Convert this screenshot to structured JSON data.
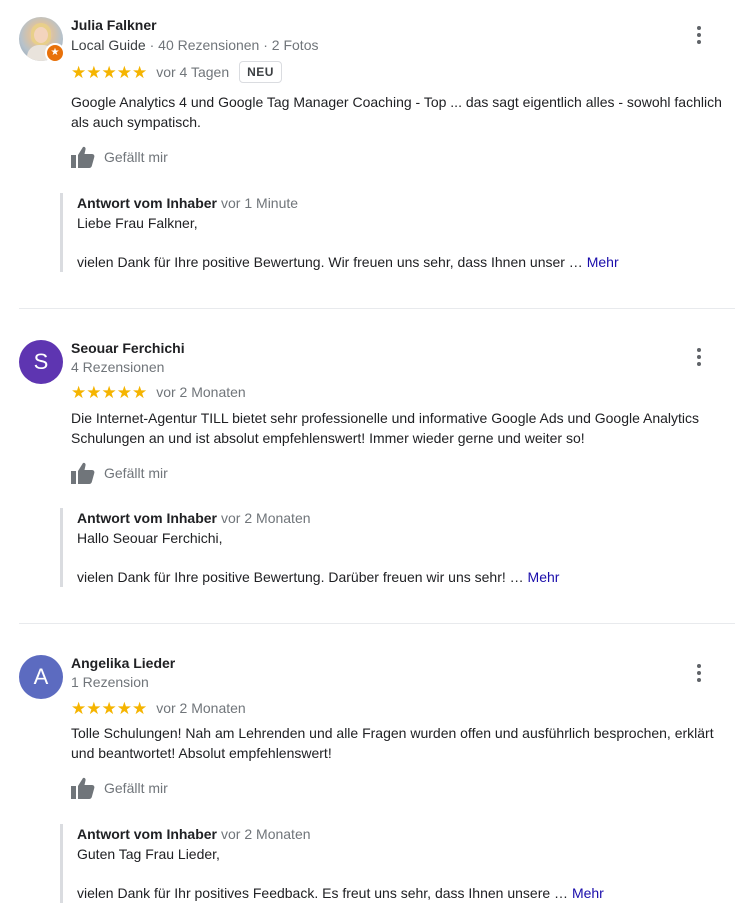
{
  "reviews": [
    {
      "name": "Julia Falkner",
      "meta_guide": "Local Guide",
      "meta_rest": " · 40 Rezensionen · 2 Fotos",
      "stars": "★★★★★",
      "date": "vor 4 Tagen",
      "badge": "NEU",
      "text": "Google Analytics 4 und Google Tag Manager Coaching - Top ... das sagt eigentlich alles - sowohl fachlich als auch sympatisch.",
      "like_label": "Gefällt mir",
      "reply": {
        "owner": "Antwort vom Inhaber",
        "date": "vor 1 Minute",
        "greeting": "Liebe Frau Falkner,",
        "body": "vielen Dank für Ihre positive Bewertung. Wir freuen uns sehr, dass Ihnen unser …",
        "more": "Mehr"
      }
    },
    {
      "name": "Seouar Ferchichi",
      "avatar_letter": "S",
      "avatar_color": "#5e35b1",
      "meta": "4 Rezensionen",
      "stars": "★★★★★",
      "date": "vor 2 Monaten",
      "text": "Die Internet-Agentur TILL bietet sehr professionelle und informative Google Ads und Google Analytics Schulungen an und ist absolut empfehlenswert! Immer wieder gerne und weiter so!",
      "like_label": "Gefällt mir",
      "reply": {
        "owner": "Antwort vom Inhaber",
        "date": "vor 2 Monaten",
        "greeting": "Hallo Seouar Ferchichi,",
        "body": "vielen Dank für Ihre positive Bewertung. Darüber freuen wir uns sehr! …",
        "more": "Mehr"
      }
    },
    {
      "name": "Angelika Lieder",
      "avatar_letter": "A",
      "avatar_color": "#5c6bc0",
      "meta": "1 Rezension",
      "stars": "★★★★★",
      "date": "vor 2 Monaten",
      "text": "Tolle Schulungen! Nah am Lehrenden und alle Fragen wurden offen und ausführlich besprochen, erklärt und beantwortet! Absolut empfehlenswert!",
      "like_label": "Gefällt mir",
      "reply": {
        "owner": "Antwort vom Inhaber",
        "date": "vor 2 Monaten",
        "greeting": "Guten Tag Frau Lieder,",
        "body": "vielen Dank für Ihr positives Feedback. Es freut uns sehr, dass Ihnen unsere …",
        "more": "Mehr"
      }
    }
  ],
  "colors": {
    "star": "#f5b400",
    "link": "#1a0dab",
    "muted": "#70757a",
    "guide_badge": "#e8710a"
  },
  "icons": {
    "thumb": "thumbs-up-icon",
    "menu": "more-vert-icon",
    "guide": "local-guide-star-icon"
  }
}
